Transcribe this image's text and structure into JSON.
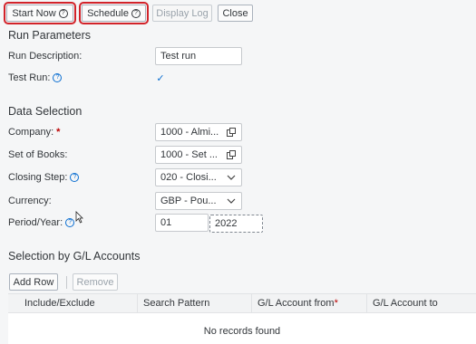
{
  "toolbar": {
    "start_now": "Start Now",
    "schedule": "Schedule",
    "display_log": "Display Log",
    "close": "Close"
  },
  "run_parameters": {
    "title": "Run Parameters",
    "run_description_label": "Run Description:",
    "run_description_value": "Test run",
    "test_run_label": "Test Run:",
    "test_run_checked": true
  },
  "data_selection": {
    "title": "Data Selection",
    "company_label": "Company:",
    "company_value": "1000 - Almi...",
    "set_of_books_label": "Set of Books:",
    "set_of_books_value": "1000 - Set ...",
    "closing_step_label": "Closing Step:",
    "closing_step_value": "020 - Closi...",
    "currency_label": "Currency:",
    "currency_value": "GBP - Pou...",
    "period_year_label": "Period/Year:",
    "period_value": "01",
    "year_value": "2022"
  },
  "selection_gl": {
    "title": "Selection by G/L Accounts",
    "add_row": "Add Row",
    "remove": "Remove",
    "columns": [
      "Include/Exclude",
      "Search Pattern",
      "G/L Account from",
      "G/L Account to"
    ],
    "empty_text": "No records found"
  },
  "icons": {
    "help": "?",
    "checkmark": "✓",
    "value_help": "copy-icon",
    "dropdown": "chevron-down-icon"
  },
  "colors": {
    "highlight": "#d2232a",
    "accent": "#0a6ed1",
    "required": "#bb0000"
  }
}
